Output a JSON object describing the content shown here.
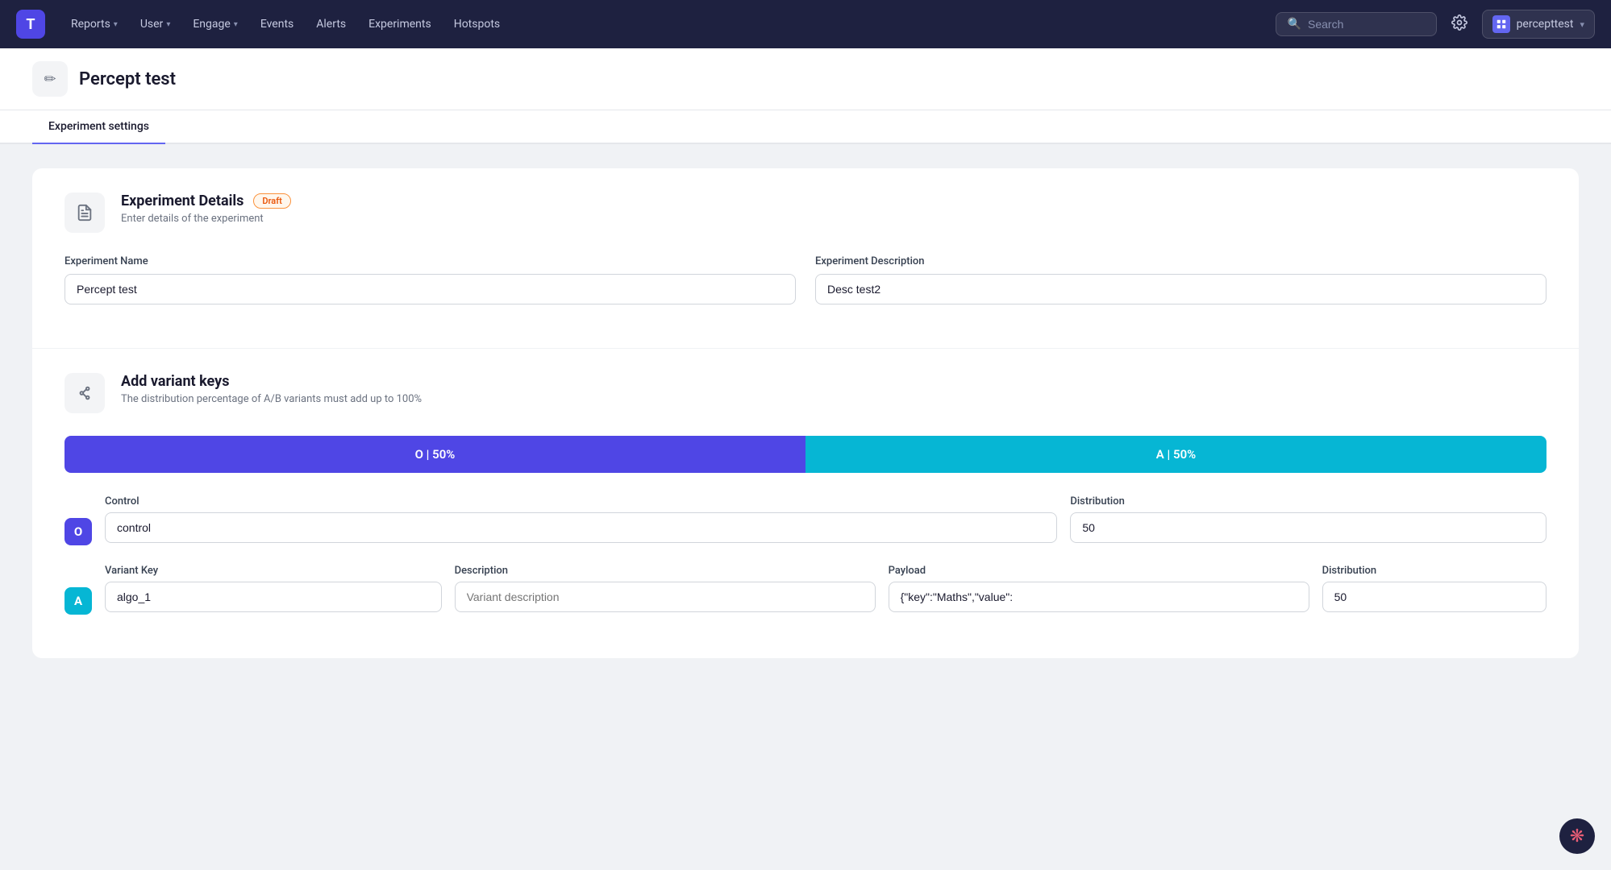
{
  "nav": {
    "logo_text": "T",
    "items": [
      {
        "label": "Reports",
        "has_dropdown": true
      },
      {
        "label": "User",
        "has_dropdown": true
      },
      {
        "label": "Engage",
        "has_dropdown": true
      },
      {
        "label": "Events",
        "has_dropdown": false
      },
      {
        "label": "Alerts",
        "has_dropdown": false
      },
      {
        "label": "Experiments",
        "has_dropdown": false
      },
      {
        "label": "Hotspots",
        "has_dropdown": false
      }
    ],
    "search_placeholder": "Search",
    "user_name": "percepttest",
    "user_icon": "P"
  },
  "page": {
    "title": "Percept test",
    "edit_icon": "✏"
  },
  "tabs": [
    {
      "label": "Experiment settings",
      "active": true
    }
  ],
  "experiment_details": {
    "title": "Experiment Details",
    "badge": "Draft",
    "subtitle": "Enter details of the experiment",
    "name_label": "Experiment Name",
    "name_value": "Percept test",
    "desc_label": "Experiment Description",
    "desc_value": "Desc test2"
  },
  "variant_keys": {
    "title": "Add variant keys",
    "subtitle": "The distribution percentage of A/B variants must add up to 100%",
    "bar_o_label": "O | 50%",
    "bar_a_label": "A | 50%",
    "control_label": "Control",
    "control_value": "control",
    "control_dist_label": "Distribution",
    "control_dist_value": "50",
    "variant_key_label": "Variant Key",
    "variant_key_value": "algo_1",
    "variant_desc_label": "Description",
    "variant_desc_placeholder": "Variant description",
    "variant_payload_label": "Payload",
    "variant_payload_value": "{\"key\":\"Maths\",\"value\":",
    "variant_dist_label": "Distribution",
    "variant_dist_value": "50"
  },
  "bottom_icon": "❋"
}
